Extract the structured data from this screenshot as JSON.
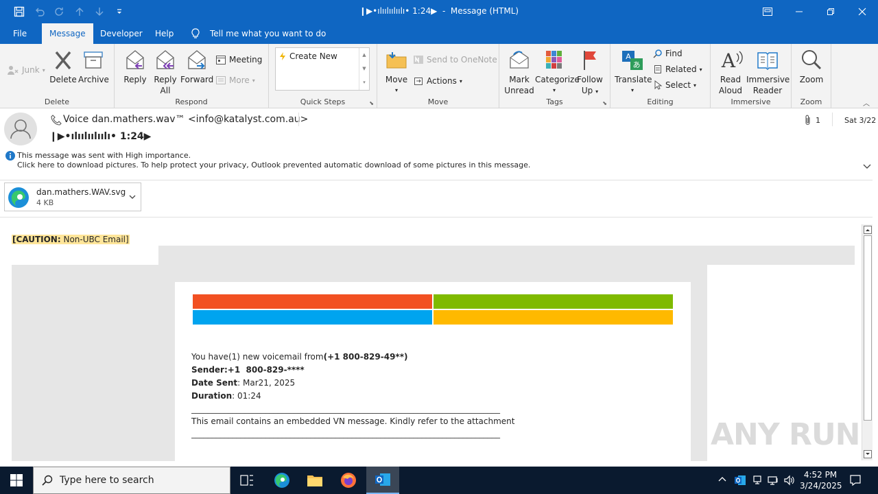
{
  "window": {
    "title": "❙▶•ılıılıılıılı• 1:24▶  -  Message (HTML)"
  },
  "menu": {
    "tabs": [
      "File",
      "Message",
      "Developer",
      "Help"
    ],
    "tell_me": "Tell me what you want to do"
  },
  "ribbon": {
    "junk": "Junk",
    "delete": "Delete",
    "archive": "Archive",
    "group_delete": "Delete",
    "reply": "Reply",
    "reply_all_1": "Reply",
    "reply_all_2": "All",
    "forward": "Forward",
    "meeting": "Meeting",
    "more": "More",
    "group_respond": "Respond",
    "create_new": "Create New",
    "group_quick_steps": "Quick Steps",
    "move": "Move",
    "send_onenote": "Send to OneNote",
    "actions": "Actions",
    "group_move": "Move",
    "mark_unread_1": "Mark",
    "mark_unread_2": "Unread",
    "categorize": "Categorize",
    "follow_up_1": "Follow",
    "follow_up_2": "Up",
    "group_tags": "Tags",
    "translate": "Translate",
    "find": "Find",
    "related": "Related",
    "select": "Select",
    "group_editing": "Editing",
    "read_aloud_1": "Read",
    "read_aloud_2": "Aloud",
    "immersive_1": "Immersive",
    "immersive_2": "Reader",
    "group_immersive": "Immersive",
    "zoom": "Zoom",
    "group_zoom": "Zoom"
  },
  "message": {
    "from": "Voice dan.mathers.wav™ <info@katalyst.com.au>",
    "subject": "❙▶•ılıılıılıılı• 1:24▶",
    "attachment_count": "1",
    "date": "Sat 3/22",
    "info_line1": "This message was sent with High importance.",
    "info_line2": "Click here to download pictures. To help protect your privacy, Outlook prevented automatic download of some pictures in this message.",
    "attachment_name": "dan.mathers.WAV.svg",
    "attachment_size": "4 KB"
  },
  "body": {
    "caution_bold": "[CAUTION:",
    "caution_rest": " Non-UBC Email]",
    "line1_a": "You have(1) new voicemail from",
    "line1_b": "(+1 800-829-49**)",
    "sender_label": "Sender",
    "sender_value": ":+1  800-829-****",
    "date_label": "Date Sent",
    "date_value": ": Mar21, 2025",
    "duration_label": "Duration",
    "duration_value": ": 01:24",
    "rule": "___________________________________________________________________________",
    "embedded": "This email contains an embedded VN message. Kindly refer to the attachment",
    "logo_colors": [
      "#f25022",
      "#7fba00",
      "#00a4ef",
      "#ffb900"
    ]
  },
  "watermark": "ANY RUN",
  "taskbar": {
    "search_placeholder": "Type here to search",
    "time": "4:52 PM",
    "date": "3/24/2025"
  }
}
